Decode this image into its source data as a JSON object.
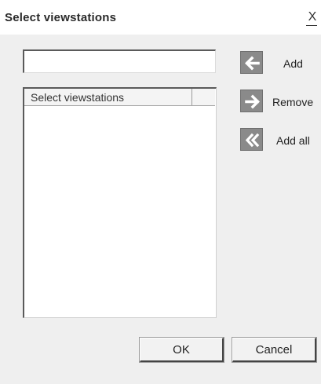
{
  "window": {
    "title": "Select viewstations",
    "close_label": "X"
  },
  "filter": {
    "value": "",
    "placeholder": ""
  },
  "list": {
    "columns": [
      "Select viewstations",
      ""
    ],
    "rows": []
  },
  "actions": {
    "add_label": "Add",
    "remove_label": "Remove",
    "add_all_label": "Add all",
    "add_icon": "arrow-left-icon",
    "remove_icon": "arrow-right-icon",
    "add_all_icon": "double-chevron-left-icon"
  },
  "footer": {
    "ok_label": "OK",
    "cancel_label": "Cancel"
  },
  "colors": {
    "dialog_bg": "#efefef",
    "icon_bg": "#8a8a8a"
  }
}
